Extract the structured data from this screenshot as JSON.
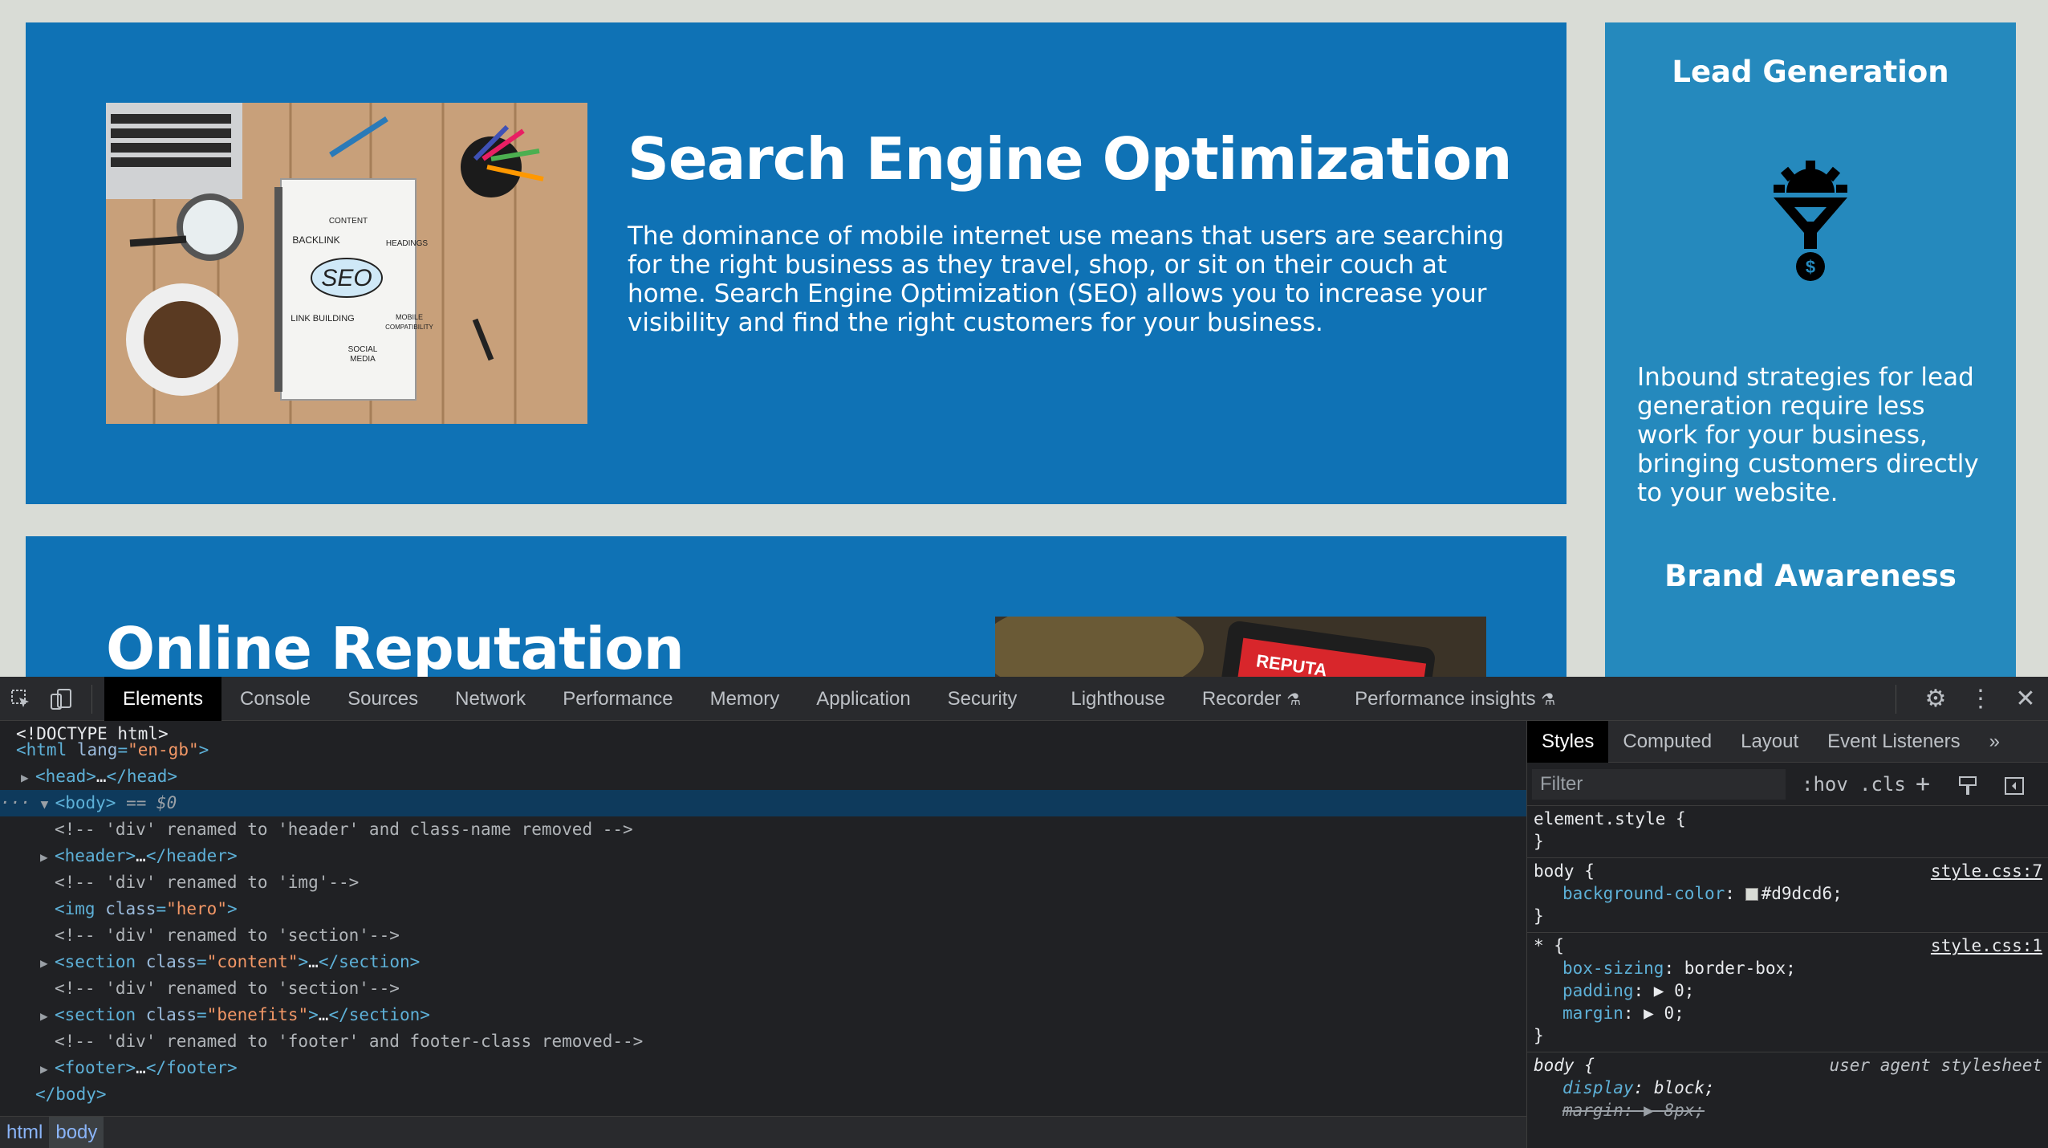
{
  "page": {
    "background_color": "#d9dcd6",
    "card_color": "#0f72b5",
    "aside_color": "#2589bd",
    "seo": {
      "title": "Search Engine Optimization",
      "text": "The dominance of mobile internet use means that users are searching for the right business as they travel, shop, or sit on their couch at home. Search Engine Optimization (SEO) allows you to increase your visibility and find the right customers for your business.",
      "image_words": [
        "CONTENT",
        "BACKLINK",
        "HEADINGS",
        "SEO",
        "LINK BUILDING",
        "MOBILE COMPATIBILITY",
        "SOCIAL MEDIA"
      ]
    },
    "reputation": {
      "title": "Online Reputation",
      "image_word": "REPUTA"
    },
    "aside": {
      "lead_title": "Lead Generation",
      "lead_text": "Inbound strategies for lead generation require less work for your business, bringing customers directly to your website.",
      "lead_icon": "funnel-gear-dollar-icon",
      "brand_title": "Brand Awareness"
    }
  },
  "devtools": {
    "tabs": [
      "Elements",
      "Console",
      "Sources",
      "Network",
      "Performance",
      "Memory",
      "Application",
      "Security",
      "Lighthouse",
      "Recorder",
      "Performance insights"
    ],
    "active_tab": "Elements",
    "dom": {
      "doctype": "<!DOCTYPE html>",
      "html_lang": "en-gb",
      "head": "head",
      "body_marker": "== $0",
      "comment1": "<!-- 'div' renamed to 'header' and class-name removed -->",
      "header": "header",
      "comment2": "<!-- 'div' renamed to 'img'-->",
      "img_class": "hero",
      "comment3": "<!-- 'div' renamed to 'section'-->",
      "section1_class": "content",
      "comment4": "<!-- 'div' renamed to 'section'-->",
      "section2_class": "benefits",
      "comment5": "<!-- 'div' renamed to 'footer' and footer-class removed-->",
      "footer": "footer",
      "body_close": "</body>"
    },
    "breadcrumbs": [
      "html",
      "body"
    ],
    "styles_tabs": [
      "Styles",
      "Computed",
      "Layout",
      "Event Listeners"
    ],
    "filter_placeholder": "Filter",
    "hov_label": ":hov",
    "cls_label": ".cls",
    "rules": {
      "element_style": "element.style {",
      "close": "}",
      "body_selector": "body {",
      "body_src": "style.css:7",
      "bg_prop": "background-color",
      "bg_val": "#d9dcd6;",
      "star_selector": "* {",
      "star_src": "style.css:1",
      "box_prop": "box-sizing",
      "box_val": "border-box;",
      "pad_prop": "padding",
      "pad_val": "0;",
      "margin_prop": "margin",
      "margin_val": "0;",
      "ua_selector": "body {",
      "ua_src": "user agent stylesheet",
      "display_prop": "display",
      "display_val": "block;",
      "ua_margin_prop": "margin",
      "ua_margin_val": "8px;"
    }
  }
}
